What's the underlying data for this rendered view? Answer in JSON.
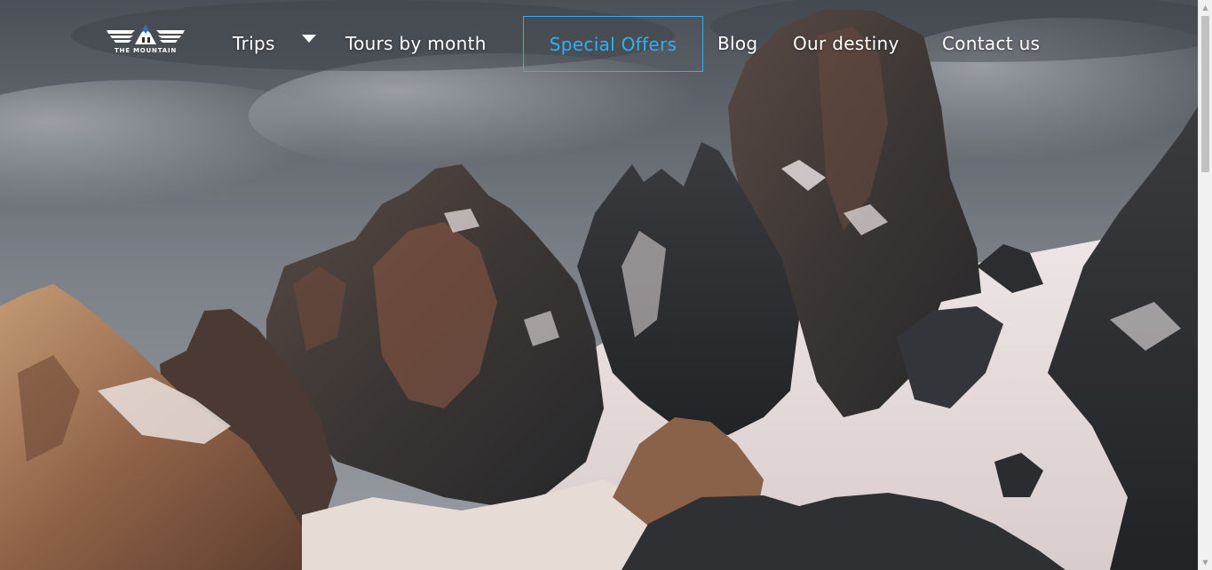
{
  "brand": {
    "logo_text": "THE MOUNTAIN",
    "logo_icon": "mountain-wings-logo"
  },
  "nav": {
    "items": [
      {
        "label": "Trips",
        "has_dropdown": true
      },
      {
        "label": "Tours by month"
      },
      {
        "label": "Special Offers",
        "active": true
      },
      {
        "label": "Blog"
      },
      {
        "label": "Our destiny"
      },
      {
        "label": "Contact us"
      }
    ]
  },
  "hero": {
    "image": "mountain-range-photo"
  },
  "colors": {
    "accent": "#2fb1f0",
    "nav_text": "#ffffff",
    "sky": "#5b6168",
    "rock_dark": "#2e2f33",
    "rock_warm": "#8a5a45",
    "snow": "#e6dede"
  }
}
